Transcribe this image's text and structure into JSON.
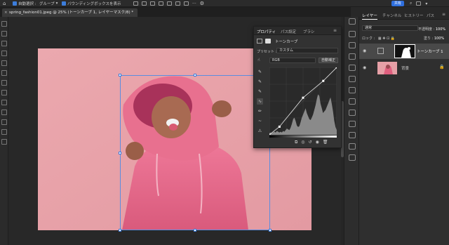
{
  "options_bar": {
    "auto_select_label": "自動選択 :",
    "auto_select_value": "グループ",
    "show_transform_label": "バウンディングボックスを表示",
    "share_label": "共有"
  },
  "document_tab": {
    "title": "spring_fashion01.jpeg @ 25% (トーンカーブ 1, レイヤーマスク/8) *",
    "close": "×"
  },
  "properties": {
    "tabs": [
      "プロパティ",
      "パス設定",
      "ブラシ"
    ],
    "section_title": "トーンカーブ",
    "preset_label": "プリセット :",
    "preset_value": "カスタム",
    "channel_value": "RGB",
    "auto_button": "自動補正",
    "curve_points": [
      [
        0,
        0
      ],
      [
        0.15,
        0.12
      ],
      [
        0.5,
        0.55
      ],
      [
        0.8,
        0.8
      ],
      [
        1,
        1
      ]
    ],
    "histogram": [
      2,
      3,
      2,
      3,
      4,
      3,
      5,
      4,
      3,
      4,
      3,
      5,
      4,
      6,
      8,
      7,
      6,
      9,
      14,
      20,
      22,
      18,
      12,
      10,
      11,
      16,
      22,
      26,
      30,
      34,
      28,
      24,
      20,
      19,
      22,
      26,
      32,
      38,
      46,
      52,
      50,
      40,
      34,
      28,
      30,
      32,
      36,
      40,
      44,
      48,
      40,
      30,
      18,
      10,
      6
    ]
  },
  "layers": {
    "tabs": [
      "レイヤー",
      "チャンネル",
      "ヒストリー",
      "パス"
    ],
    "blend_mode": "通常",
    "opacity_label": "不透明度 :",
    "opacity_value": "100%",
    "lock_label": "ロック :",
    "fill_label": "塗り :",
    "fill_value": "100%",
    "items": [
      {
        "name": "トーンカーブ 1",
        "selected": true
      },
      {
        "name": "背景",
        "selected": false
      }
    ]
  },
  "colors": {
    "accent": "#2f6fde",
    "photo_bg": "#e6a0a7",
    "hoodie": "#e46a8a"
  }
}
